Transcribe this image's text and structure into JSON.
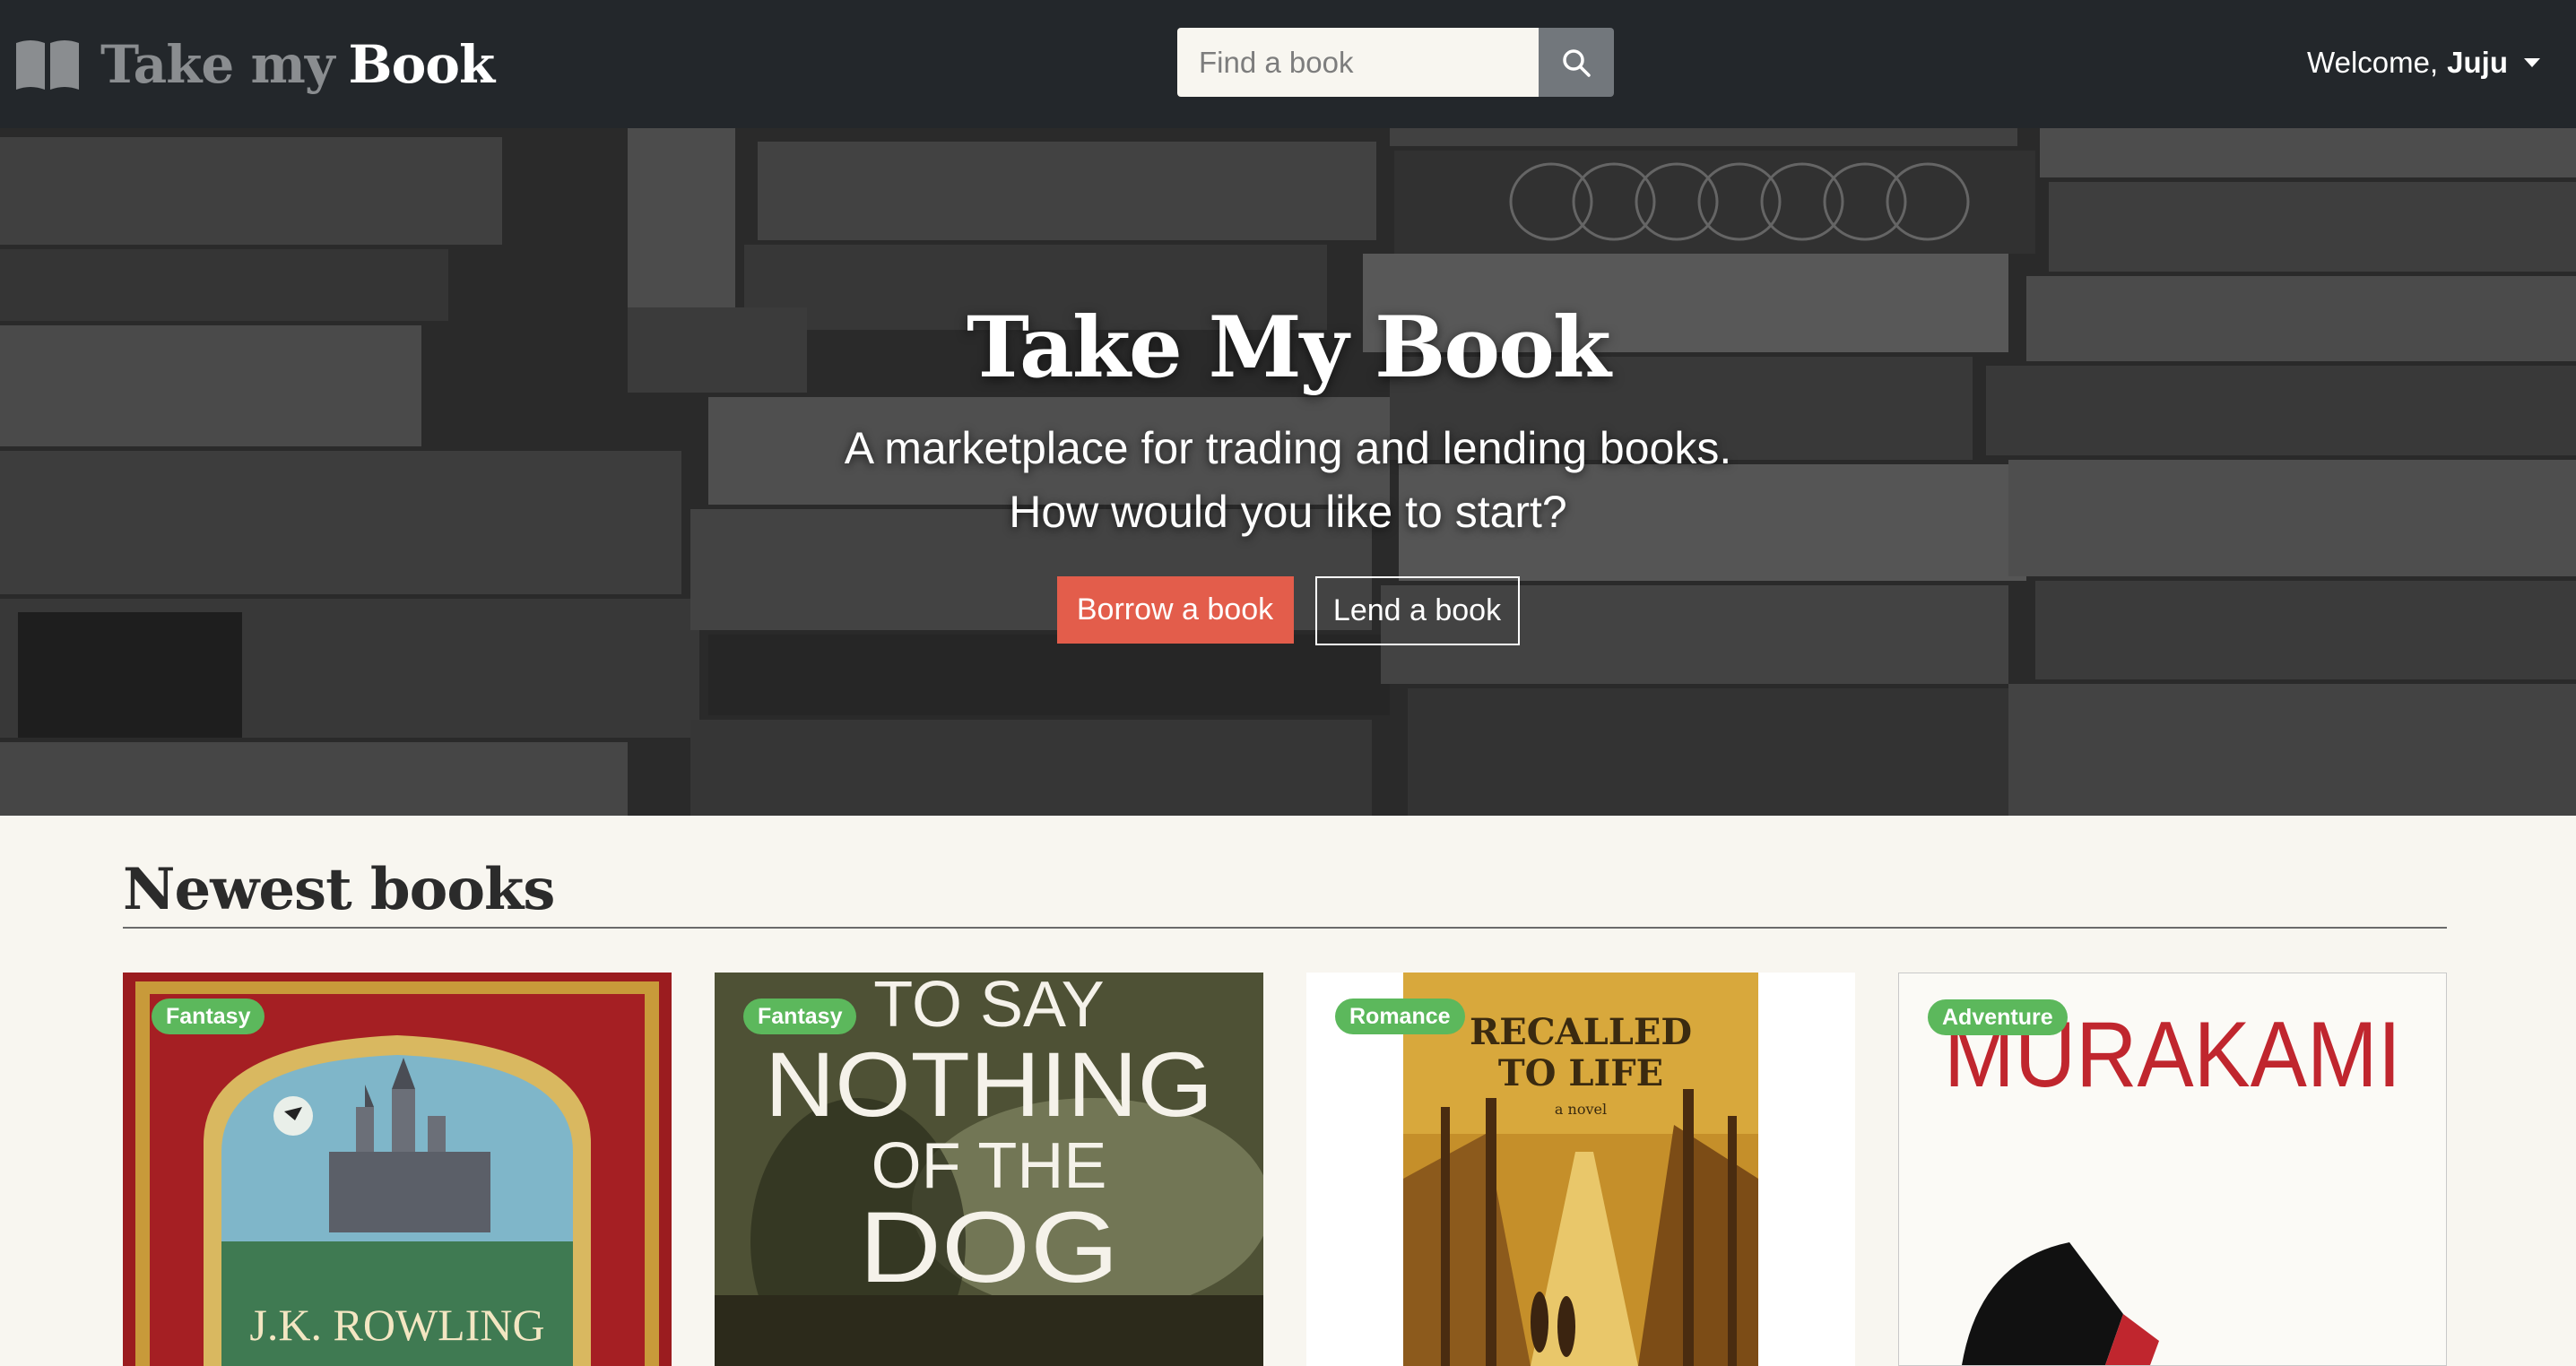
{
  "brand": {
    "take": "Take my",
    "book": "Book",
    "icon": "open-book-icon"
  },
  "search": {
    "placeholder": "Find a book",
    "icon": "search-icon"
  },
  "user": {
    "greeting": "Welcome,",
    "name": "Juju",
    "icon": "caret-down-icon"
  },
  "hero": {
    "title": "Take My Book",
    "subtitle_line1": "A marketplace for trading and lending books.",
    "subtitle_line2": "How would you like to start?",
    "borrow_label": "Borrow a book",
    "lend_label": "Lend a book"
  },
  "newest": {
    "heading": "Newest books",
    "books": [
      {
        "genre": "Fantasy",
        "cover_text": "J.K. ROWLING"
      },
      {
        "genre": "Fantasy",
        "cover_text": [
          "TO SAY",
          "NOTHING",
          "OF THE",
          "DOG"
        ]
      },
      {
        "genre": "Romance",
        "cover_text": [
          "RECALLED",
          "TO LIFE",
          "a novel"
        ]
      },
      {
        "genre": "Adventure",
        "cover_text": "MURAKAMI"
      }
    ]
  },
  "colors": {
    "navbar": "#23272b",
    "accent_red": "#e35d4b",
    "badge_green": "#5cb85c",
    "page_bg": "#f8f6f0"
  }
}
